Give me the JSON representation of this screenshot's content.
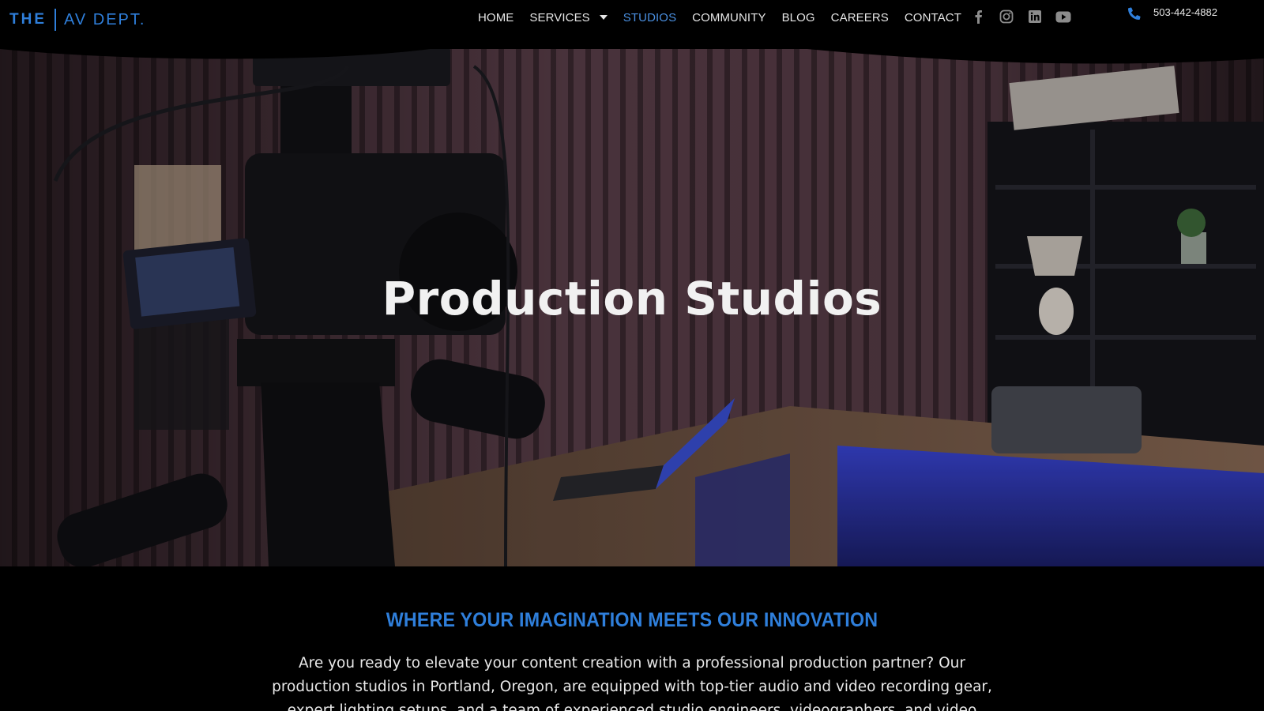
{
  "logo": {
    "the": "THE",
    "name": "AV DEPT."
  },
  "nav": {
    "items": [
      {
        "label": "HOME",
        "active": false
      },
      {
        "label": "SERVICES",
        "active": false,
        "has_dropdown": true
      },
      {
        "label": "STUDIOS",
        "active": true
      },
      {
        "label": "COMMUNITY",
        "active": false
      },
      {
        "label": "BLOG",
        "active": false
      },
      {
        "label": "CAREERS",
        "active": false
      },
      {
        "label": "CONTACT",
        "active": false
      }
    ]
  },
  "social": [
    "facebook-icon",
    "instagram-icon",
    "linkedin-icon",
    "youtube-icon"
  ],
  "contact": {
    "phone": "503-442-4882",
    "icon": "phone-icon"
  },
  "hero": {
    "title": "Production Studios"
  },
  "content": {
    "tagline": "WHERE YOUR IMAGINATION MEETS OUR INNOVATION",
    "intro": "Are you ready to elevate your content creation with a professional production partner? Our production studios in Portland, Oregon, are equipped with top-tier audio and video recording gear, expert lighting setups, and a team of experienced studio engineers, videographers, and video editors dedicated to"
  },
  "colors": {
    "accent": "#2f7fdb",
    "active_nav": "#4a8fe0",
    "background": "#000000"
  }
}
